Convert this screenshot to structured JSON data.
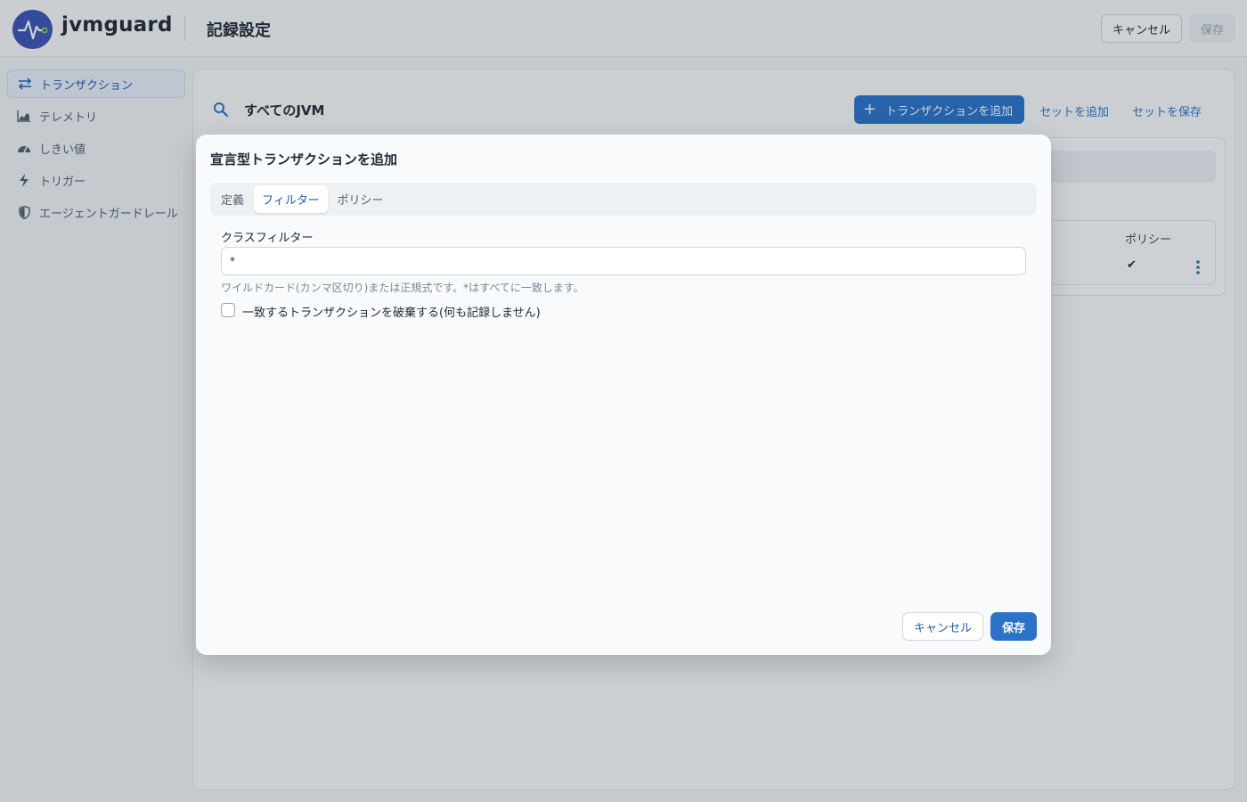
{
  "header": {
    "brand": "jvmguard",
    "page_title": "記録設定",
    "cancel_label": "キャンセル",
    "save_label": "保存"
  },
  "sidebar": {
    "items": [
      {
        "label": "トランザクション",
        "icon": "transactions-icon",
        "active": true
      },
      {
        "label": "テレメトリ",
        "icon": "area-chart-icon",
        "active": false
      },
      {
        "label": "しきい値",
        "icon": "gauge-icon",
        "active": false
      },
      {
        "label": "トリガー",
        "icon": "lightning-icon",
        "active": false
      },
      {
        "label": "エージェントガードレール",
        "icon": "shield-icon",
        "active": false
      }
    ]
  },
  "main": {
    "scope_label": "すべてのJVM",
    "add_transaction_label": "トランザクションを追加",
    "add_set_label": "セットを追加",
    "save_set_label": "セットを保存",
    "table": {
      "policy_header": "ポリシー",
      "row_check": "✔"
    }
  },
  "dialog": {
    "title": "宣言型トランザクションを追加",
    "tabs": [
      {
        "label": "定義",
        "active": false
      },
      {
        "label": "フィルター",
        "active": true
      },
      {
        "label": "ポリシー",
        "active": false
      }
    ],
    "class_filter": {
      "label": "クラスフィルター",
      "value": "*",
      "help": "ワイルドカード(カンマ区切り)または正規式です。*はすべてに一致します。"
    },
    "discard_checkbox": {
      "label": "一致するトランザクションを破棄する(何も記録しません)",
      "checked": false
    },
    "cancel_label": "キャンセル",
    "save_label": "保存"
  },
  "colors": {
    "accent": "#2a73c9",
    "logo_bg": "#3b53b6"
  }
}
